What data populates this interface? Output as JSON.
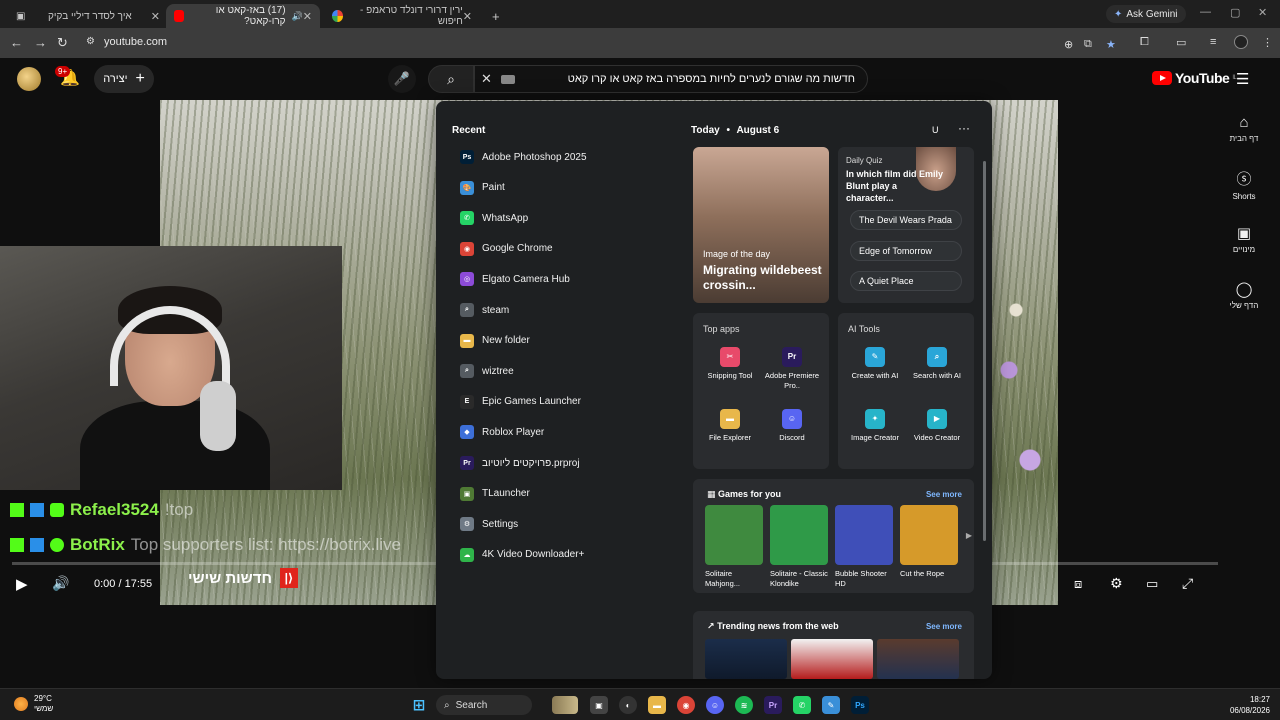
{
  "browser": {
    "tabs": [
      {
        "title": "איך לסדר דיליי בקיק",
        "active": false
      },
      {
        "title": "(17) באז-קאט או קרו-קאט?",
        "active": true
      },
      {
        "title": "ירין דרורי דונלד טראמפ - חיפוש",
        "active": false
      }
    ],
    "new_tab": "+",
    "ask_gemini": "Ask Gemini",
    "url": "youtube.com"
  },
  "youtube": {
    "notif_count": "9+",
    "create_label": "יצירה",
    "search_query": "חדשות מה שגורם לנערים לחיות במספרה באז קאט או קרו קאט",
    "logo_text": "YouTube",
    "logo_region": "IL",
    "guide": [
      {
        "icon": "home-icon",
        "label": "דף הבית"
      },
      {
        "icon": "shorts-icon",
        "label": "Shorts"
      },
      {
        "icon": "subscriptions-icon",
        "label": "מינויים"
      },
      {
        "icon": "you-icon",
        "label": "הדף שלי"
      }
    ],
    "player": {
      "time": "0:00 / 17:55",
      "progress": 0,
      "overlay_tag": "חדשות שישי"
    },
    "chat": [
      {
        "user": "Refael3524",
        "text": "!top",
        "color": "#8cf04b"
      },
      {
        "user": "BotRix",
        "text": "Top supporters list: https://botrix.live",
        "color": "#8cf04b"
      }
    ]
  },
  "start_menu": {
    "recent_title": "Recent",
    "recent": [
      {
        "name": "Adobe Photoshop 2025",
        "icon": "photoshop-icon",
        "color": "#001e36",
        "glyph": "Ps"
      },
      {
        "name": "Paint",
        "icon": "paint-icon",
        "color": "#3a8fd8",
        "glyph": "🎨"
      },
      {
        "name": "WhatsApp",
        "icon": "whatsapp-icon",
        "color": "#25d366",
        "glyph": "✆"
      },
      {
        "name": "Google Chrome",
        "icon": "chrome-icon",
        "color": "#db4437",
        "glyph": "◉"
      },
      {
        "name": "Elgato Camera Hub",
        "icon": "camera-hub-icon",
        "color": "#8c4bd8",
        "glyph": "◎"
      },
      {
        "name": "steam",
        "icon": "search-icon",
        "color": "#555b61",
        "glyph": "⌕"
      },
      {
        "name": "New folder",
        "icon": "folder-icon",
        "color": "#e8b74a",
        "glyph": "▬"
      },
      {
        "name": "wiztree",
        "icon": "search-icon",
        "color": "#555b61",
        "glyph": "⌕"
      },
      {
        "name": "Epic Games Launcher",
        "icon": "epic-games-icon",
        "color": "#2a2a2a",
        "glyph": "E"
      },
      {
        "name": "Roblox Player",
        "icon": "roblox-icon",
        "color": "#3d6fd8",
        "glyph": "◆"
      },
      {
        "name": "פרויקטים ליוטיוב.prproj",
        "icon": "premiere-project-icon",
        "color": "#2a1b5c",
        "glyph": "Pr"
      },
      {
        "name": "TLauncher",
        "icon": "tlauncher-icon",
        "color": "#4f7a34",
        "glyph": "▣"
      },
      {
        "name": "Settings",
        "icon": "gear-icon",
        "color": "#6f7a86",
        "glyph": "⚙"
      },
      {
        "name": "4K Video Downloader+",
        "icon": "downloader-icon",
        "color": "#2fb44a",
        "glyph": "☁"
      }
    ],
    "today_label": "Today",
    "today_date": "August 6",
    "today_user": "U",
    "image_of_day": {
      "label": "Image of the day",
      "title": "Migrating wildebeest crossin..."
    },
    "quiz": {
      "label": "Daily Quiz",
      "question": "In which film did Emily Blunt play a character...",
      "options": [
        "The Devil Wears Prada",
        "Edge of Tomorrow",
        "A Quiet Place"
      ]
    },
    "top_apps": {
      "title": "Top apps",
      "items": [
        {
          "name": "Snipping Tool",
          "icon": "snipping-tool-icon",
          "color": "#e84a6a",
          "glyph": "✂"
        },
        {
          "name": "Adobe Premiere Pro..",
          "icon": "premiere-icon",
          "color": "#2a1b5c",
          "glyph": "Pr"
        },
        {
          "name": "File Explorer",
          "icon": "file-explorer-icon",
          "color": "#e8b74a",
          "glyph": "▬"
        },
        {
          "name": "Discord",
          "icon": "discord-icon",
          "color": "#5865f2",
          "glyph": "☺"
        }
      ]
    },
    "ai_tools": {
      "title": "AI Tools",
      "items": [
        {
          "name": "Create with AI",
          "icon": "create-ai-icon",
          "color": "#2aa6d8",
          "glyph": "✎"
        },
        {
          "name": "Search with AI",
          "icon": "search-ai-icon",
          "color": "#2aa6d8",
          "glyph": "⌕"
        },
        {
          "name": "Image Creator",
          "icon": "image-creator-icon",
          "color": "#27b4c9",
          "glyph": "✦"
        },
        {
          "name": "Video Creator",
          "icon": "video-creator-icon",
          "color": "#27b4c9",
          "glyph": "▶"
        }
      ]
    },
    "games": {
      "title": "Games for you",
      "see_more": "See more",
      "items": [
        {
          "name": "Solitaire Mahjong...",
          "color": "#3f8a3f"
        },
        {
          "name": "Solitaire - Classic Klondike",
          "color": "#2f9a48"
        },
        {
          "name": "Bubble Shooter HD",
          "color": "#3f4fb8"
        },
        {
          "name": "Cut the Rope",
          "color": "#d69a2a"
        }
      ]
    },
    "news": {
      "title": "Trending news from the web",
      "see_more": "See more"
    }
  },
  "taskbar": {
    "weather_temp": "29°C",
    "weather_desc": "שמשי",
    "search_placeholder": "Search",
    "time": "18:27",
    "date": "06/08/2026"
  }
}
